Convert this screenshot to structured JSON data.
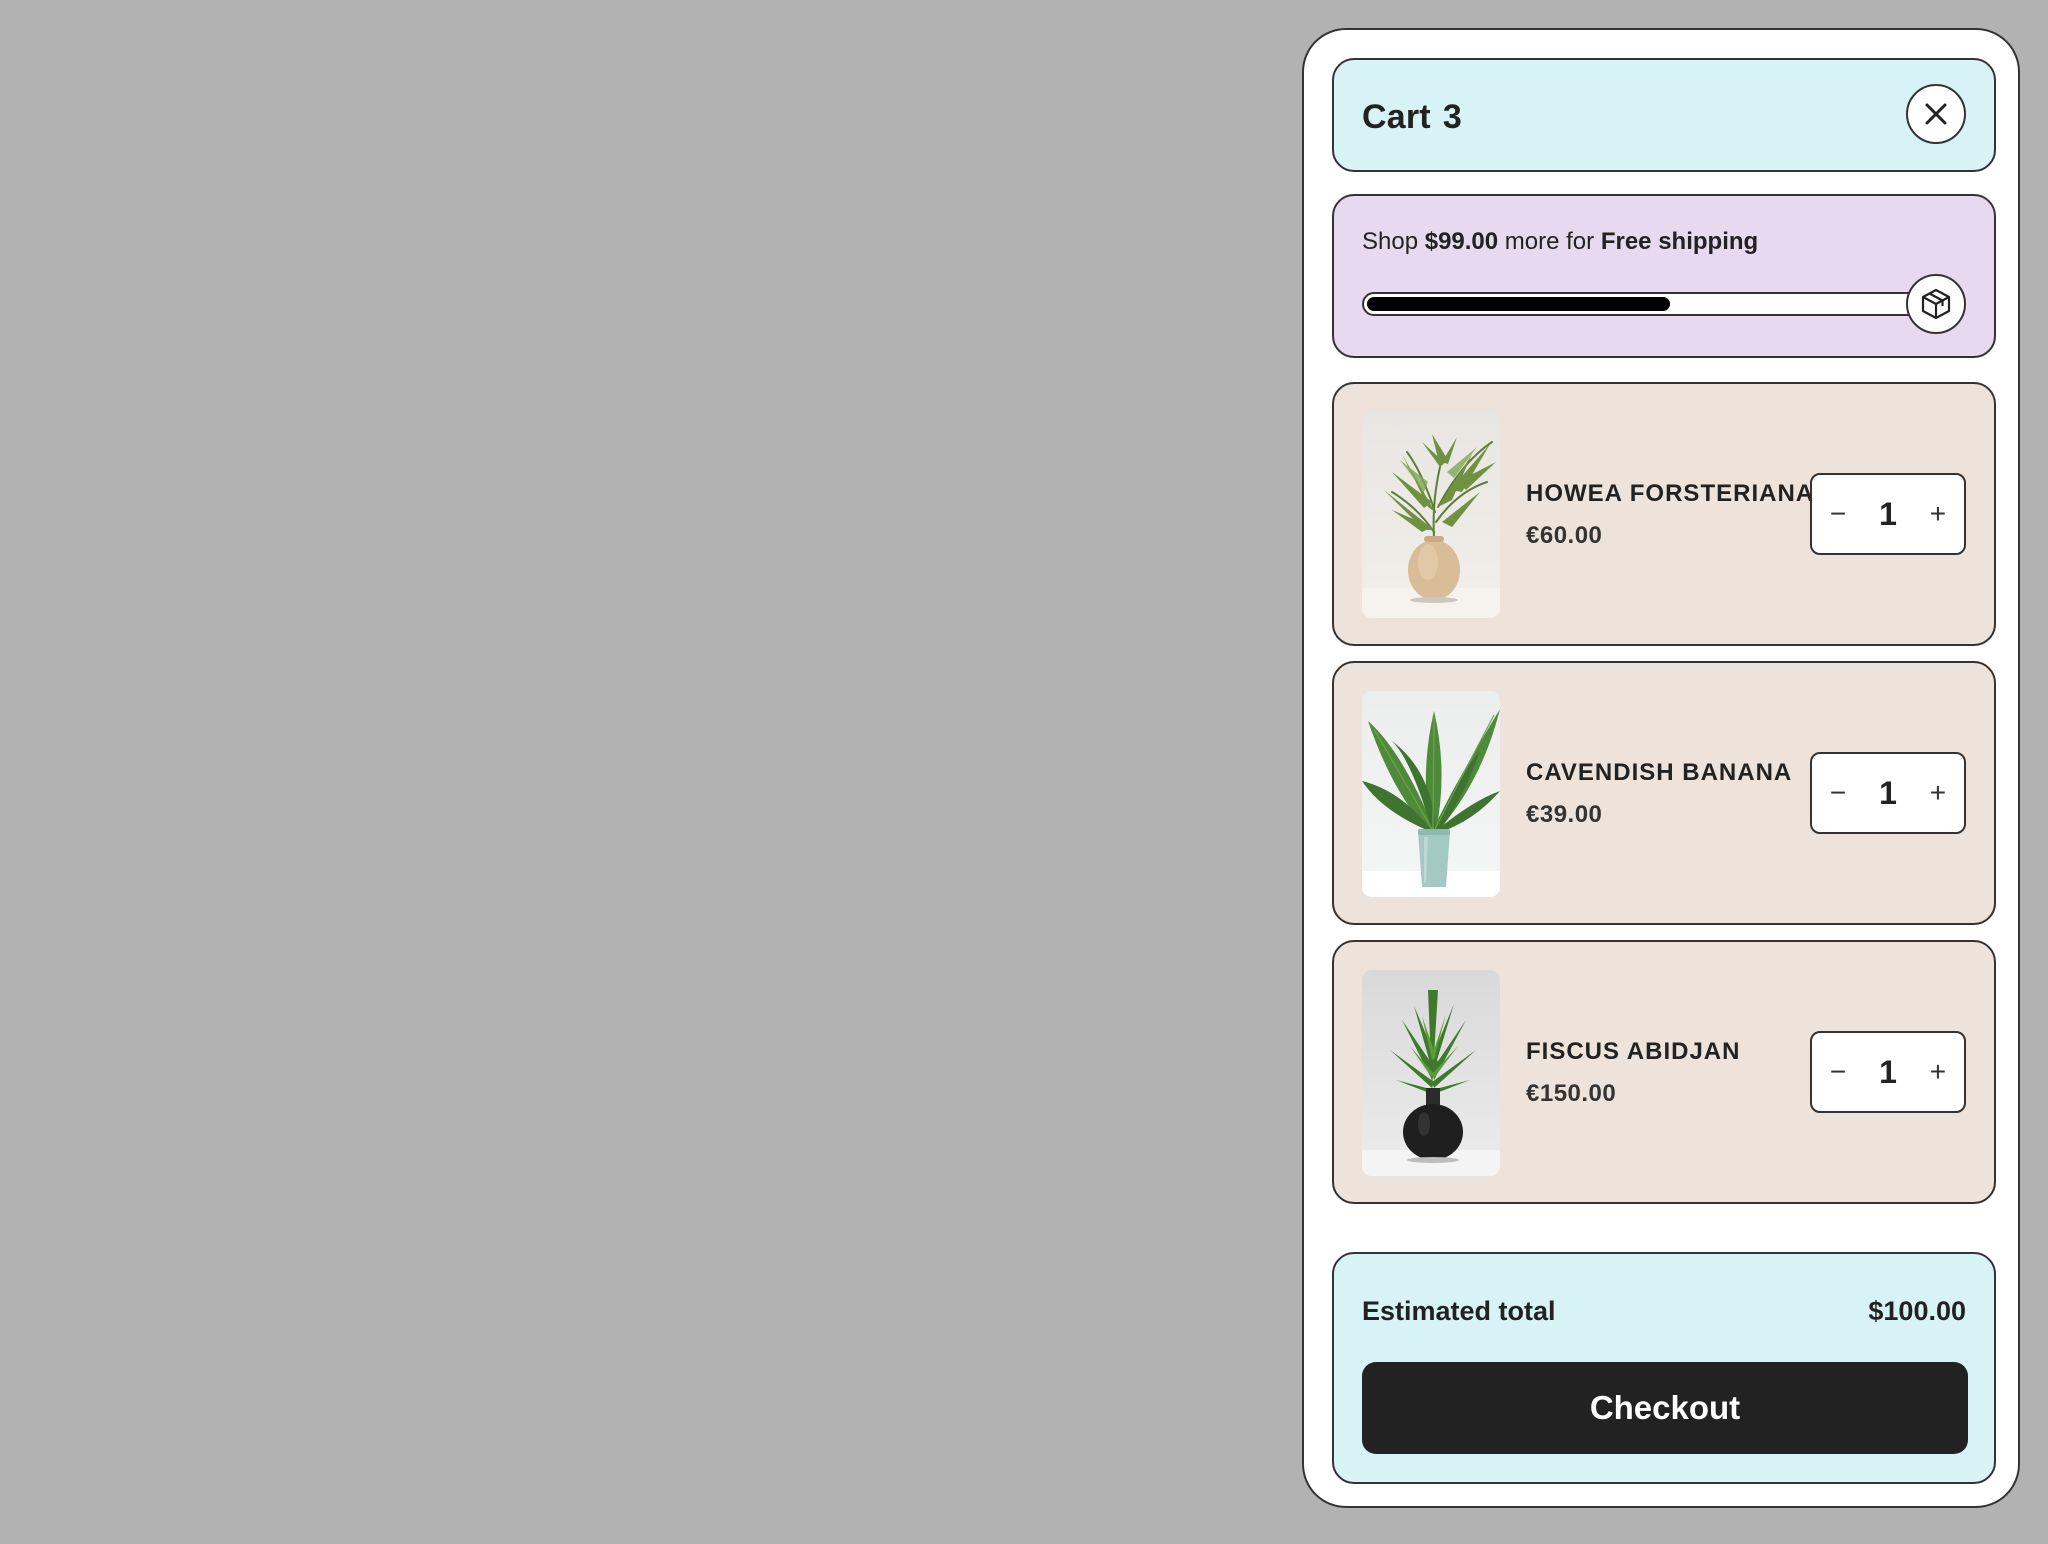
{
  "cart": {
    "title": "Cart",
    "count": "3",
    "close_icon": "close-icon"
  },
  "shipping": {
    "prefix": "Shop ",
    "amount": "$99.00",
    "middle": " more for ",
    "label": "Free shipping",
    "progress_percent": 55,
    "icon": "box-icon"
  },
  "items": [
    {
      "name": "HOWEA FORSTERIANA",
      "price": "€60.00",
      "quantity": "1"
    },
    {
      "name": "CAVENDISH BANANA",
      "price": "€39.00",
      "quantity": "1"
    },
    {
      "name": "FISCUS ABIDJAN",
      "price": "€150.00",
      "quantity": "1"
    }
  ],
  "stepper": {
    "minus": "−",
    "plus": "+"
  },
  "summary": {
    "label": "Estimated total",
    "value": "$100.00",
    "checkout_label": "Checkout"
  },
  "colors": {
    "backdrop": "#b2b2b2",
    "header_bg": "#d8f3f6",
    "shipping_bg": "#e7d9ef",
    "item_bg": "#ede3da",
    "checkout_bg": "#222222"
  }
}
